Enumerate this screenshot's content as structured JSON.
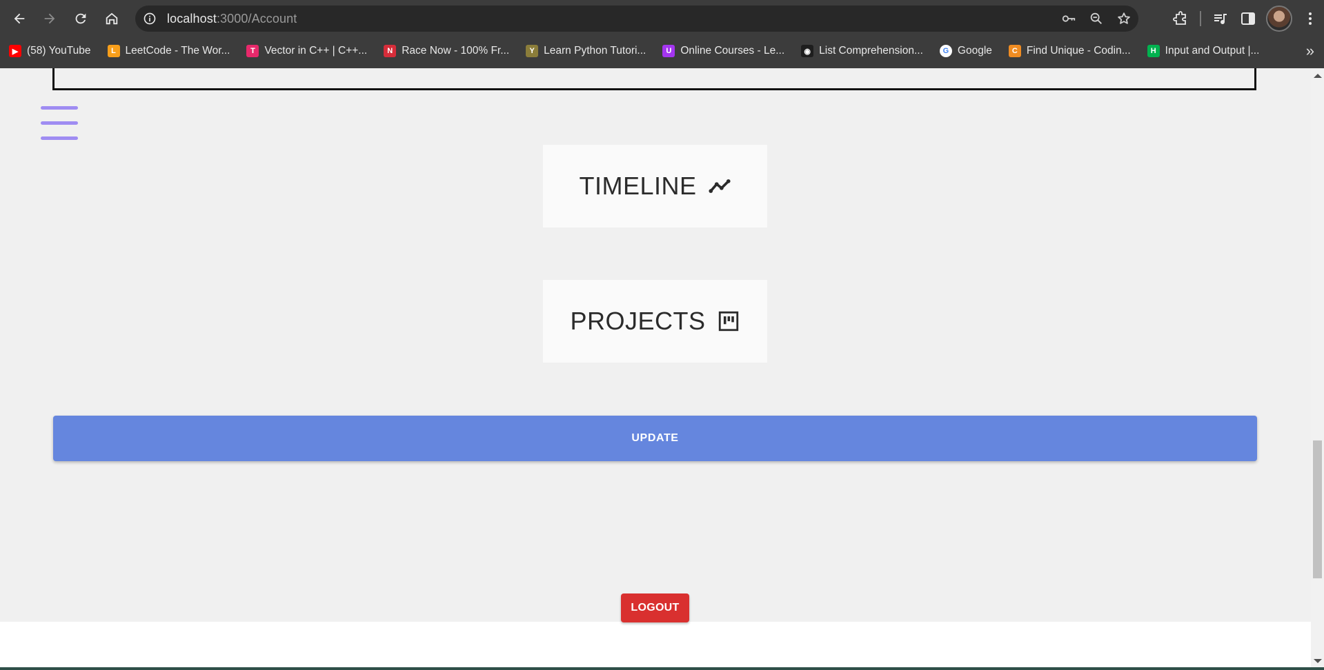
{
  "browser": {
    "url_host": "localhost",
    "url_path": ":3000/Account",
    "bookmarks": [
      {
        "label": "(58) YouTube",
        "icon": "youtube-icon",
        "color": "#ff0000"
      },
      {
        "label": "LeetCode - The Wor...",
        "icon": "leetcode-icon",
        "color": "#f89f1b"
      },
      {
        "label": "Vector in C++ | C++...",
        "icon": "scaler-icon",
        "color": "#e8296b"
      },
      {
        "label": "Race Now - 100% Fr...",
        "icon": "nitrotype-icon",
        "color": "#d62d3a"
      },
      {
        "label": "Learn Python Tutori...",
        "icon": "python-tutorial-icon",
        "color": "#8b7d3a"
      },
      {
        "label": "Online Courses - Le...",
        "icon": "udemy-icon",
        "color": "#a435f0"
      },
      {
        "label": "List Comprehension...",
        "icon": "list-comprehension-icon",
        "color": "#1e1e1e"
      },
      {
        "label": "Google",
        "icon": "google-icon",
        "color": "#4285f4"
      },
      {
        "label": "Find Unique - Codin...",
        "icon": "codingninjas-icon",
        "color": "#f08c22"
      },
      {
        "label": "Input and Output |...",
        "icon": "hackerrank-icon",
        "color": "#00b24f"
      }
    ]
  },
  "page": {
    "timeline_label": "TIMELINE",
    "projects_label": "PROJECTS",
    "update_label": "UPDATE",
    "logout_label": "LOGOUT",
    "accent_color": "#9f8cf2",
    "update_color": "#6586de",
    "logout_color": "#d9302f"
  }
}
